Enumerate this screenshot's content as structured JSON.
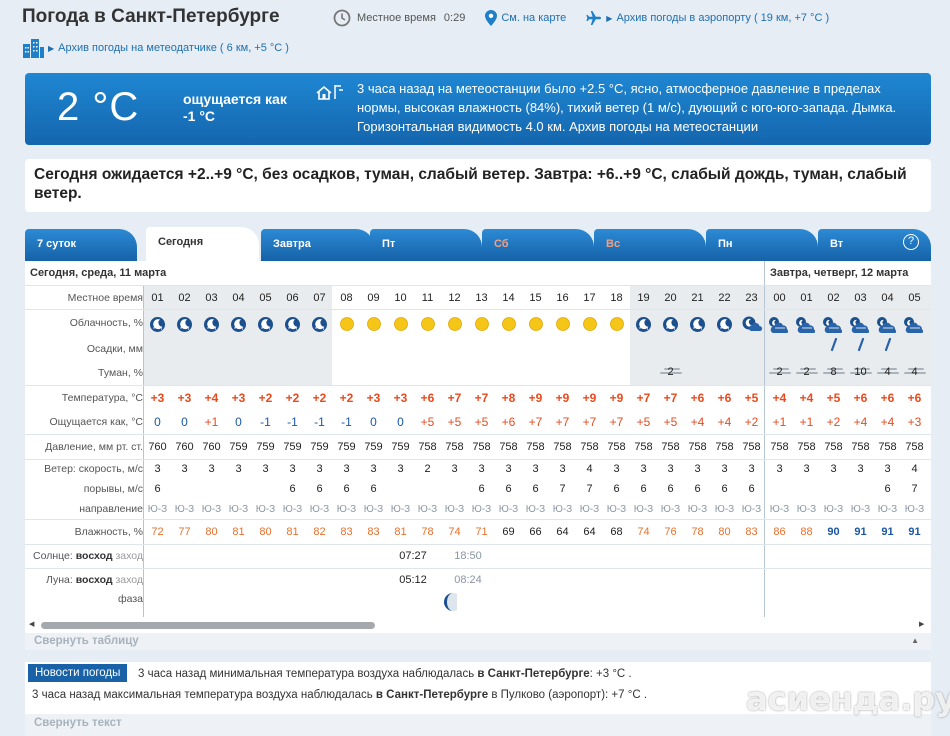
{
  "header": {
    "title": "Погода в Санкт-Петербурге",
    "local_time_label": "Местное время",
    "local_time": "0:29",
    "map_link": "См. на карте",
    "airport_link": "Архив погоды в аэропорту ( 19 км, +7 °С )",
    "station_link": "Архив погоды на метеодатчике ( 6 км, +5 °С )"
  },
  "now": {
    "temp": "2 °C",
    "feels": "ощущается как -1 °С",
    "description": "3 часа назад на метеостанции было +2.5 °С, ясно, атмосферное давление в пределах нормы, высокая влажность (84%), тихий ветер (1 м/с), дующий с юго-юго-запада. Дымка. Горизонтальная видимость 4.0 км. Архив погоды на метеостанции"
  },
  "forecast_text": "Сегодня ожидается +2..+9 °С, без осадков, туман, слабый ветер. Завтра: +6..+9 °С, слабый дождь, туман, слабый ветер.",
  "tabs": [
    {
      "label": "7 суток"
    },
    {
      "label": "Сегодня"
    },
    {
      "label": "Завтра"
    },
    {
      "label": "Пт"
    },
    {
      "label": "Сб"
    },
    {
      "label": "Вс"
    },
    {
      "label": "Пн"
    },
    {
      "label": "Вт"
    }
  ],
  "help_label": "?",
  "table": {
    "day1_header": "Сегодня, среда, 11 марта",
    "day2_header": "Завтра, четверг, 12 марта",
    "labels": {
      "time": "Местное время",
      "clouds": "Облачность, %",
      "precip": "Осадки, мм",
      "fog": "Туман, %",
      "temp": "Температура, °С",
      "feels": "Ощущается как, °С",
      "pressure": "Давление, мм рт. ст.",
      "wind_speed": "Ветер: скорость, м/с",
      "gusts": "порывы, м/с",
      "direction": "направление",
      "humidity": "Влажность, %",
      "sun": "Солнце:",
      "sun_rise": "восход",
      "sun_set": "заход",
      "moon": "Луна:",
      "moon_rise": "восход",
      "moon_set": "заход",
      "moon_phase": "фаза"
    },
    "hours": [
      "01",
      "02",
      "03",
      "04",
      "05",
      "06",
      "07",
      "08",
      "09",
      "10",
      "11",
      "12",
      "13",
      "14",
      "15",
      "16",
      "17",
      "18",
      "19",
      "20",
      "21",
      "22",
      "23",
      "00",
      "01",
      "02",
      "03",
      "04",
      "05"
    ],
    "sky": [
      "n",
      "n",
      "n",
      "n",
      "n",
      "n",
      "n",
      "s",
      "s",
      "s",
      "s",
      "s",
      "s",
      "s",
      "s",
      "s",
      "s",
      "s",
      "n",
      "n",
      "n",
      "n",
      "nc",
      "c",
      "c",
      "c",
      "c",
      "c",
      "c"
    ],
    "rain": [
      "",
      "",
      "",
      "",
      "",
      "",
      "",
      "",
      "",
      "",
      "",
      "",
      "",
      "",
      "",
      "",
      "",
      "",
      "",
      "",
      "",
      "",
      "",
      "",
      "",
      "r",
      "r",
      "r",
      ""
    ],
    "fog": [
      "",
      "",
      "",
      "",
      "",
      "",
      "",
      "",
      "",
      "",
      "",
      "",
      "",
      "",
      "",
      "",
      "",
      "",
      "",
      "2",
      "",
      "",
      "",
      "2",
      "2",
      "8",
      "10",
      "4",
      "4"
    ],
    "temp": [
      "+3",
      "+3",
      "+4",
      "+3",
      "+2",
      "+2",
      "+2",
      "+2",
      "+3",
      "+3",
      "+6",
      "+7",
      "+7",
      "+8",
      "+9",
      "+9",
      "+9",
      "+9",
      "+7",
      "+7",
      "+6",
      "+6",
      "+5",
      "+4",
      "+4",
      "+5",
      "+6",
      "+6",
      "+6"
    ],
    "feels": [
      "0",
      "0",
      "+1",
      "0",
      "-1",
      "-1",
      "-1",
      "-1",
      "0",
      "0",
      "+5",
      "+5",
      "+5",
      "+6",
      "+7",
      "+7",
      "+7",
      "+7",
      "+5",
      "+5",
      "+4",
      "+4",
      "+2",
      "+1",
      "+1",
      "+2",
      "+4",
      "+4",
      "+3"
    ],
    "pressure": [
      "760",
      "760",
      "760",
      "759",
      "759",
      "759",
      "759",
      "759",
      "759",
      "759",
      "758",
      "758",
      "758",
      "758",
      "758",
      "758",
      "758",
      "758",
      "758",
      "758",
      "758",
      "758",
      "758",
      "758",
      "758",
      "758",
      "758",
      "758",
      "758"
    ],
    "wind": [
      "3",
      "3",
      "3",
      "3",
      "3",
      "3",
      "3",
      "3",
      "3",
      "3",
      "2",
      "3",
      "3",
      "3",
      "3",
      "3",
      "4",
      "3",
      "3",
      "3",
      "3",
      "3",
      "3",
      "3",
      "3",
      "3",
      "3",
      "3",
      "4"
    ],
    "gusts": [
      "6",
      "",
      "",
      "",
      "",
      "6",
      "6",
      "6",
      "6",
      "",
      "",
      "",
      "6",
      "6",
      "6",
      "7",
      "7",
      "6",
      "6",
      "6",
      "6",
      "6",
      "6",
      "",
      "",
      "",
      "",
      "6",
      "7"
    ],
    "direction": [
      "Ю-З",
      "Ю-З",
      "Ю-З",
      "Ю-З",
      "Ю-З",
      "Ю-З",
      "Ю-З",
      "Ю-З",
      "Ю-З",
      "Ю-З",
      "Ю-З",
      "Ю-З",
      "Ю-З",
      "Ю-З",
      "Ю-З",
      "Ю-З",
      "Ю-З",
      "Ю-З",
      "Ю-З",
      "Ю-З",
      "Ю-З",
      "Ю-З",
      "Ю-З",
      "Ю-З",
      "Ю-З",
      "Ю-З",
      "Ю-З",
      "Ю-З",
      "Ю-З"
    ],
    "humidity": [
      "72",
      "77",
      "80",
      "81",
      "80",
      "81",
      "82",
      "83",
      "83",
      "81",
      "78",
      "74",
      "71",
      "69",
      "66",
      "64",
      "64",
      "68",
      "74",
      "76",
      "78",
      "80",
      "83",
      "86",
      "88",
      "90",
      "91",
      "91",
      "91"
    ],
    "sunrise": "07:27",
    "sunset": "18:50",
    "moonrise": "05:12",
    "moonset": "08:24",
    "collapse_label": "Свернуть таблицу"
  },
  "news": {
    "tag": "Новости погоды",
    "line1_pre": "3 часа назад минимальная температура воздуха наблюдалась ",
    "line1_city": "в Санкт-Петербурге",
    "line1_post": ": +3 °С .",
    "line2_pre": "3 часа назад максимальная температура воздуха наблюдалась ",
    "line2_city": "в Санкт-Петербурге",
    "line2_post": " в Пулково (аэропорт): +7 °С .",
    "collapse_label": "Свернуть текст"
  },
  "watermark": "асиенда.ру",
  "colors": {
    "accent": "#1a6fb8",
    "temp": "#e84a1e",
    "sun": "#f5c518"
  }
}
